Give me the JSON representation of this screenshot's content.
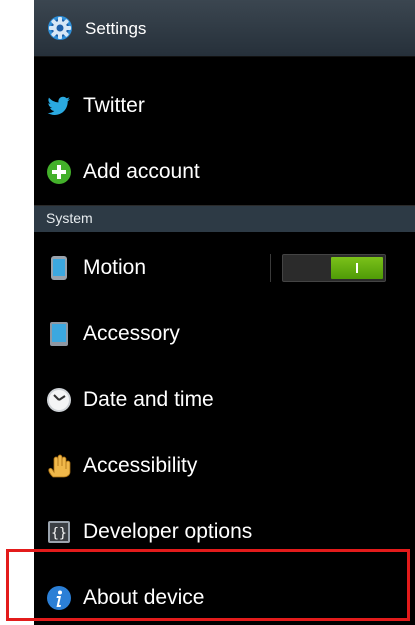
{
  "app": {
    "title": "Settings",
    "title_icon": "gear-icon"
  },
  "accounts": {
    "twitter": {
      "label": "Twitter",
      "icon": "twitter-bird-icon"
    },
    "add_account": {
      "label": "Add account",
      "icon": "plus-circle-icon"
    }
  },
  "system": {
    "header": "System",
    "items": [
      {
        "label": "Motion",
        "icon": "phone-icon",
        "toggle": {
          "state": "on",
          "label": "I"
        }
      },
      {
        "label": "Accessory",
        "icon": "tablet-icon"
      },
      {
        "label": "Date and time",
        "icon": "clock-icon"
      },
      {
        "label": "Accessibility",
        "icon": "hand-icon"
      },
      {
        "label": "Developer options",
        "icon": "braces-icon"
      },
      {
        "label": "About device",
        "icon": "info-icon"
      }
    ]
  },
  "colors": {
    "highlight": "#e31b1b",
    "toggle_on": "#6fb514",
    "header_bg": "#2d3a45"
  }
}
